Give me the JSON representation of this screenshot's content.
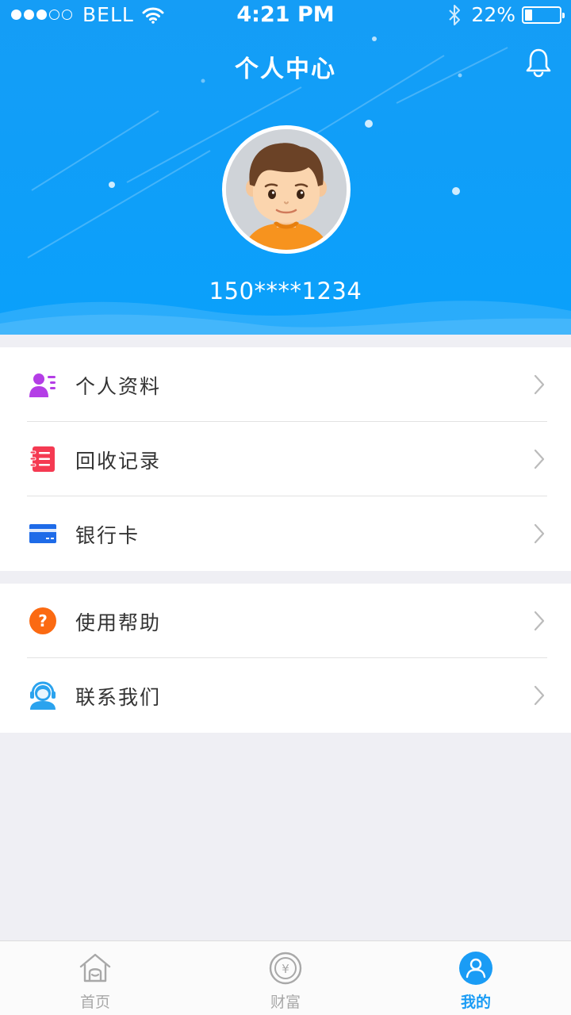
{
  "status_bar": {
    "carrier": "BELL",
    "time": "4:21 PM",
    "battery_percent_text": "22%",
    "battery_level": 0.22,
    "signal_bars_filled": 3,
    "signal_bars_total": 5
  },
  "header": {
    "title": "个人中心",
    "phone": "150****1234",
    "bell_icon": "bell-icon"
  },
  "menu_group_1": [
    {
      "label": "个人资料",
      "icon": "profile-card-icon",
      "color": "#b43ee6"
    },
    {
      "label": "回收记录",
      "icon": "notebook-icon",
      "color": "#f53a52"
    },
    {
      "label": "银行卡",
      "icon": "bank-card-icon",
      "color": "#1e6be8"
    }
  ],
  "menu_group_2": [
    {
      "label": "使用帮助",
      "icon": "help-icon",
      "color": "#fb6a12"
    },
    {
      "label": "联系我们",
      "icon": "customer-service-icon",
      "color": "#2ba3ee"
    }
  ],
  "tabbar": {
    "tabs": [
      {
        "label": "首页",
        "icon": "home-icon",
        "active": false
      },
      {
        "label": "财富",
        "icon": "yen-coin-icon",
        "active": false
      },
      {
        "label": "我的",
        "icon": "user-icon",
        "active": true
      }
    ]
  },
  "colors": {
    "primary": "#0ba0fa",
    "active_tab": "#1a9cf5",
    "background": "#efeff4"
  }
}
